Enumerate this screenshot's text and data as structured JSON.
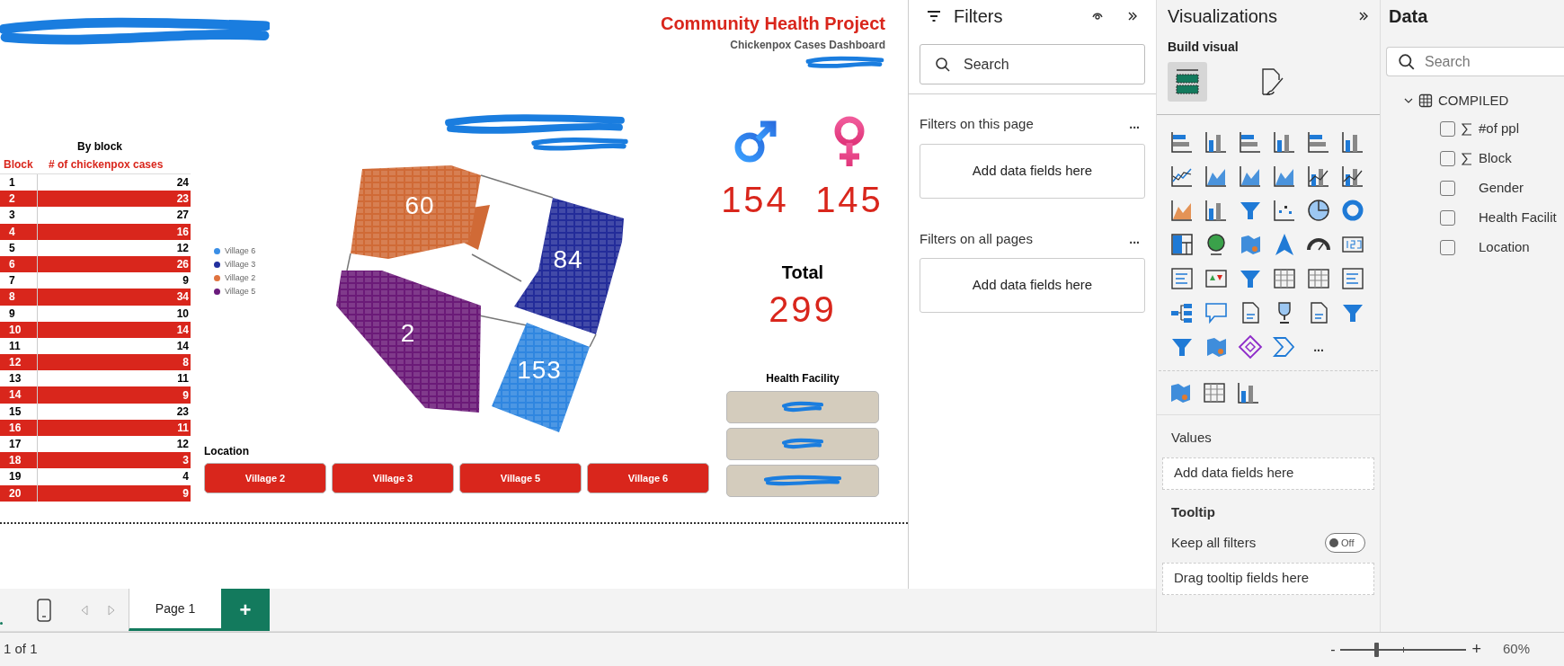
{
  "report": {
    "title": "Community Health Project",
    "subtitle": "Chickenpox Cases Dashboard",
    "block_table": {
      "title": "By block",
      "columns": [
        "Block",
        "# of chickenpox cases"
      ],
      "rows": [
        [
          "1",
          "24"
        ],
        [
          "2",
          "23"
        ],
        [
          "3",
          "27"
        ],
        [
          "4",
          "16"
        ],
        [
          "5",
          "12"
        ],
        [
          "6",
          "26"
        ],
        [
          "7",
          "9"
        ],
        [
          "8",
          "34"
        ],
        [
          "9",
          "10"
        ],
        [
          "10",
          "14"
        ],
        [
          "11",
          "14"
        ],
        [
          "12",
          "8"
        ],
        [
          "13",
          "11"
        ],
        [
          "14",
          "9"
        ],
        [
          "15",
          "23"
        ],
        [
          "16",
          "11"
        ],
        [
          "17",
          "12"
        ],
        [
          "18",
          "3"
        ],
        [
          "19",
          "4"
        ],
        [
          "20",
          "9"
        ]
      ]
    },
    "map": {
      "legend": [
        {
          "label": "Village 6",
          "color": "#3a8ee6"
        },
        {
          "label": "Village 3",
          "color": "#22309e"
        },
        {
          "label": "Village 2",
          "color": "#e0733f"
        },
        {
          "label": "Village 5",
          "color": "#6a1b7c"
        }
      ],
      "regions": [
        {
          "label": "60",
          "color": "#d06a36"
        },
        {
          "label": "84",
          "color": "#232c9a"
        },
        {
          "label": "2",
          "color": "#6b1a78"
        },
        {
          "label": "153",
          "color": "#2f86e0"
        }
      ]
    },
    "location_slicer": {
      "title": "Location",
      "options": [
        "Village 2",
        "Village 3",
        "Village 5",
        "Village 6"
      ]
    },
    "gender": [
      {
        "kind": "male",
        "count": "154"
      },
      {
        "kind": "female",
        "count": "145"
      }
    ],
    "total": {
      "label": "Total",
      "value": "299"
    },
    "health_facility": {
      "title": "Health Facility",
      "options": [
        {
          "kind": "redacted"
        },
        {
          "kind": "redacted"
        },
        {
          "kind": "redacted"
        }
      ]
    }
  },
  "filters": {
    "title": "Filters",
    "search": {
      "placeholder": "Search"
    },
    "sections": [
      {
        "title": "Filters on this page",
        "more": "...",
        "drop": "Add data fields here"
      },
      {
        "title": "Filters on all pages",
        "more": "...",
        "drop": "Add data fields here"
      }
    ]
  },
  "visualizations": {
    "title": "Visualizations",
    "subtitle": "Build visual",
    "tabs": [
      {
        "kind": "build",
        "selected": true
      },
      {
        "kind": "format",
        "selected": false
      }
    ],
    "more": "...",
    "wells": [
      {
        "kind": "drop",
        "title": "Values",
        "drop": "Add data fields here"
      },
      {
        "kind": "toggle",
        "title": "Tooltip",
        "label": "Keep all filters",
        "toggle": "Off",
        "on": false,
        "drop": "Drag tooltip fields here"
      }
    ]
  },
  "data": {
    "title": "Data",
    "search": {
      "placeholder": "Search"
    },
    "tables": [
      {
        "name": "COMPILED",
        "expanded": true,
        "fields": [
          {
            "name": "#of ppl",
            "kind": "numeric",
            "checked": false
          },
          {
            "name": "Block",
            "kind": "numeric",
            "checked": false
          },
          {
            "name": "Gender",
            "kind": "text",
            "checked": false
          },
          {
            "name": "Health Facilit",
            "kind": "text",
            "checked": false
          },
          {
            "name": "Location",
            "kind": "text",
            "checked": false
          }
        ]
      }
    ]
  },
  "pages": {
    "tabs": [
      {
        "label": "Page 1",
        "selected": true
      }
    ],
    "add": "+"
  },
  "status_bar": {
    "page": "1 of 1",
    "zoom_out": "-",
    "zoom_in": "+",
    "zoom": "60%",
    "level": 0.28
  }
}
